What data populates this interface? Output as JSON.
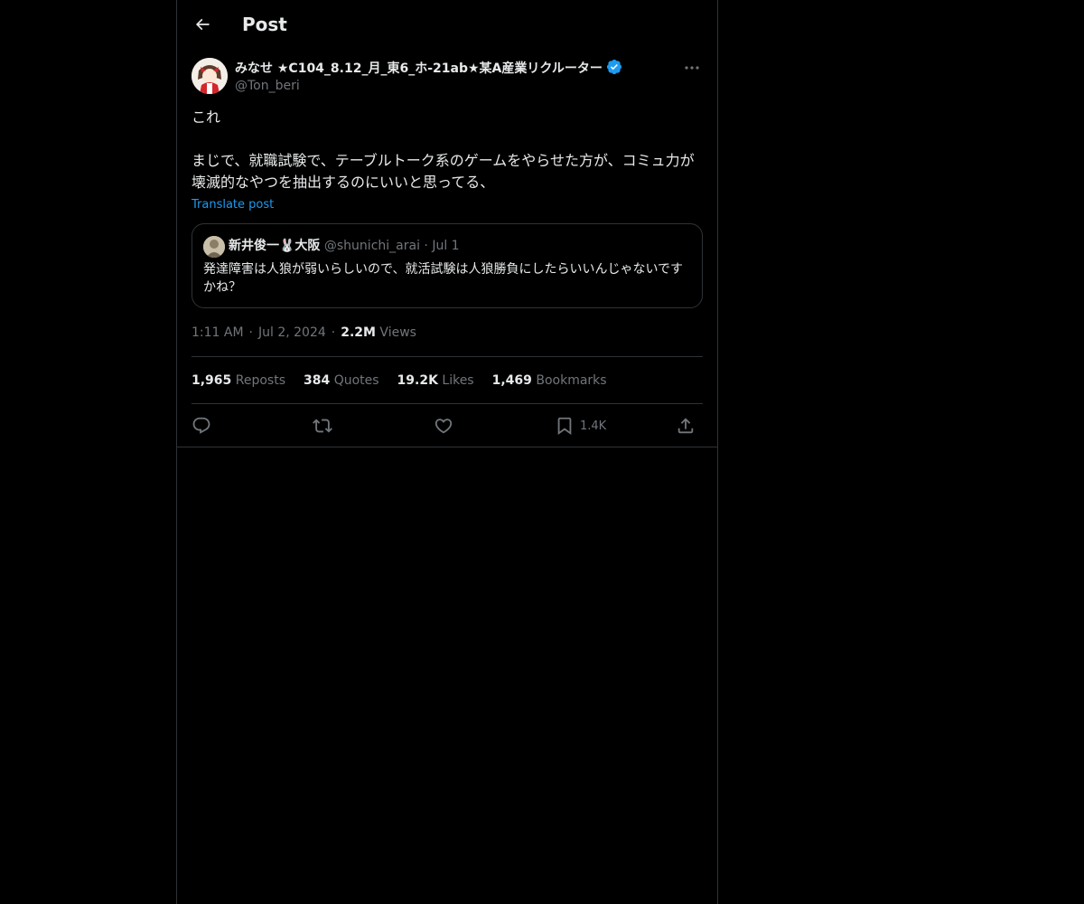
{
  "header": {
    "title": "Post"
  },
  "author": {
    "display_name": "みなせ ★C104_8.12_月_東6_ホ-21ab★某A産業リクルーター",
    "handle": "@Ton_beri"
  },
  "tweet": {
    "line1": "これ",
    "line2": "まじで、就職試験で、テーブルトーク系のゲームをやらせた方が、コミュ力が壊滅的なやつを抽出するのにいいと思ってる、",
    "translate_label": "Translate post"
  },
  "quote": {
    "name": "新井俊一🐰大阪",
    "handle": "@shunichi_arai",
    "separator": "·",
    "date": "Jul 1",
    "text": "発達障害は人狼が弱いらしいので、就活試験は人狼勝負にしたらいいんじゃないですかね？"
  },
  "meta": {
    "time": "1:11 AM",
    "separator": "·",
    "date": "Jul 2, 2024",
    "views_count": "2.2M",
    "views_label": "Views"
  },
  "stats": [
    {
      "count": "1,965",
      "label": "Reposts"
    },
    {
      "count": "384",
      "label": "Quotes"
    },
    {
      "count": "19.2K",
      "label": "Likes"
    },
    {
      "count": "1,469",
      "label": "Bookmarks"
    }
  ],
  "actions": {
    "bookmark_count": "1.4K"
  },
  "icons": {
    "back": "back-arrow-icon",
    "verified": "verified-badge-icon",
    "more": "more-options-icon",
    "reply": "reply-icon",
    "repost": "repost-icon",
    "like": "like-icon",
    "bookmark": "bookmark-icon",
    "share": "share-icon"
  },
  "colors": {
    "background": "#000000",
    "text": "#e7e9ea",
    "muted": "#71767b",
    "accent": "#1d9bf0",
    "border": "#2f3336"
  }
}
